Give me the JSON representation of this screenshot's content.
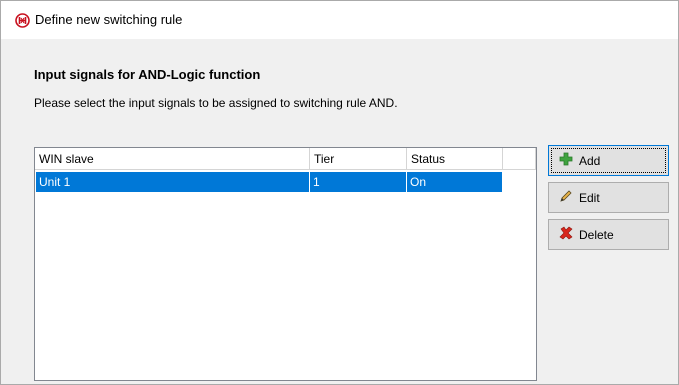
{
  "window": {
    "title": "Define new switching rule",
    "icon": "switching-rule-icon"
  },
  "section": {
    "heading": "Input signals for AND-Logic function",
    "description": "Please select the input signals to be assigned to switching rule AND."
  },
  "table": {
    "columns": [
      "WIN slave",
      "Tier",
      "Status"
    ],
    "rows": [
      {
        "win_slave": "Unit 1",
        "tier": "1",
        "status": "On"
      }
    ],
    "selected_row_color": "#0078d7"
  },
  "buttons": {
    "add_label": "Add",
    "edit_label": "Edit",
    "delete_label": "Delete"
  }
}
